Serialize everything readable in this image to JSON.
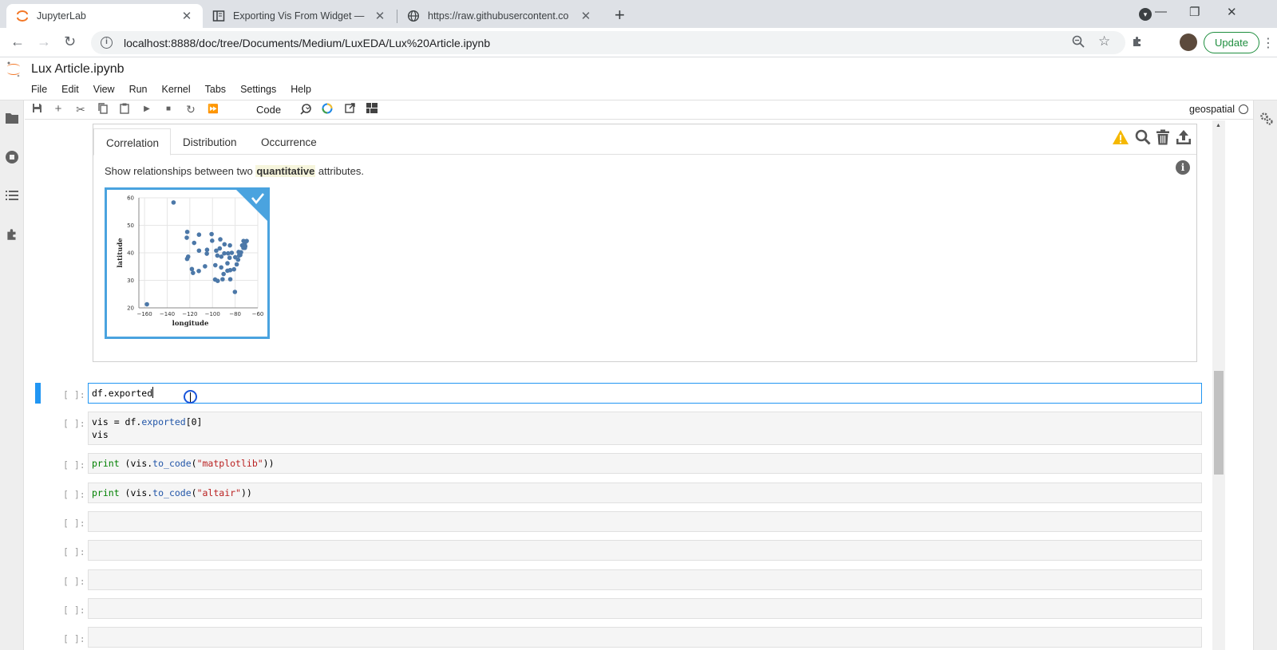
{
  "browser": {
    "tabs": [
      {
        "title": "JupyterLab",
        "active": true
      },
      {
        "title": "Exporting Vis From Widget — Lu"
      },
      {
        "title": "https://raw.githubusercontent.co"
      }
    ],
    "url": "localhost:8888/doc/tree/Documents/Medium/LuxEDA/Lux%20Article.ipynb",
    "update_label": "Update"
  },
  "jupyter": {
    "doc_title": "Lux Article.ipynb",
    "menu": [
      "File",
      "Edit",
      "View",
      "Run",
      "Kernel",
      "Tabs",
      "Settings",
      "Help"
    ],
    "cell_type": "Code",
    "kernel": "geospatial"
  },
  "lux": {
    "tabs": [
      "Correlation",
      "Distribution",
      "Occurrence"
    ],
    "active_tab": "Correlation",
    "desc_before": "Show relationships between two ",
    "desc_highlight": "quantitative",
    "desc_after": " attributes.",
    "accent": "#4aa3df"
  },
  "chart_data": {
    "type": "scatter",
    "xlabel": "longitude",
    "ylabel": "latitude",
    "xlim": [
      -165,
      -60
    ],
    "ylim": [
      20,
      60
    ],
    "xticks": [
      "−160",
      "−140",
      "−120",
      "−100",
      "−80",
      "−60"
    ],
    "yticks": [
      "20",
      "30",
      "40",
      "50",
      "60"
    ],
    "grid": true,
    "point_color": "#4c78a8",
    "points": [
      [
        -157.9,
        21.3
      ],
      [
        -134.4,
        58.3
      ],
      [
        -122.3,
        47.6
      ],
      [
        -122.7,
        45.5
      ],
      [
        -121.5,
        38.6
      ],
      [
        -122.4,
        37.8
      ],
      [
        -118.2,
        34.1
      ],
      [
        -117.2,
        32.7
      ],
      [
        -116.2,
        43.6
      ],
      [
        -111.9,
        40.8
      ],
      [
        -112.1,
        33.4
      ],
      [
        -111.9,
        46.6
      ],
      [
        -106.6,
        35.1
      ],
      [
        -105.0,
        39.7
      ],
      [
        -104.8,
        41.1
      ],
      [
        -100.8,
        46.8
      ],
      [
        -100.3,
        44.4
      ],
      [
        -96.7,
        40.8
      ],
      [
        -95.7,
        39.0
      ],
      [
        -97.5,
        35.5
      ],
      [
        -97.7,
        30.3
      ],
      [
        -95.4,
        29.8
      ],
      [
        -93.1,
        44.9
      ],
      [
        -93.6,
        41.6
      ],
      [
        -92.2,
        38.6
      ],
      [
        -92.3,
        34.7
      ],
      [
        -91.1,
        30.4
      ],
      [
        -89.4,
        43.1
      ],
      [
        -89.6,
        39.8
      ],
      [
        -90.2,
        32.3
      ],
      [
        -86.8,
        33.5
      ],
      [
        -86.8,
        36.2
      ],
      [
        -84.9,
        38.2
      ],
      [
        -86.2,
        39.8
      ],
      [
        -84.6,
        42.7
      ],
      [
        -83.0,
        40.0
      ],
      [
        -84.4,
        33.7
      ],
      [
        -84.3,
        30.4
      ],
      [
        -81.0,
        34.0
      ],
      [
        -78.6,
        35.8
      ],
      [
        -77.4,
        37.5
      ],
      [
        -79.9,
        38.4
      ],
      [
        -76.9,
        40.3
      ],
      [
        -76.5,
        39.0
      ],
      [
        -75.5,
        39.2
      ],
      [
        -74.8,
        40.2
      ],
      [
        -73.8,
        42.7
      ],
      [
        -72.7,
        41.8
      ],
      [
        -71.4,
        41.8
      ],
      [
        -71.1,
        42.4
      ],
      [
        -71.5,
        43.2
      ],
      [
        -72.6,
        44.3
      ],
      [
        -69.8,
        44.3
      ],
      [
        -80.2,
        25.8
      ]
    ]
  },
  "cells": [
    {
      "prompt": "[ ]:",
      "code": "df.exported"
    },
    {
      "prompt": "[ ]:",
      "line1_a": "vis = df.",
      "line1_b": "exported",
      "line1_c": "[0]",
      "line2": "vis"
    },
    {
      "prompt": "[ ]:",
      "kw": "print",
      "pre": " (vis.",
      "fn": "to_code",
      "p1": "(",
      "str": "\"matplotlib\"",
      "p2": "))"
    },
    {
      "prompt": "[ ]:",
      "kw": "print",
      "pre": " (vis.",
      "fn": "to_code",
      "p1": "(",
      "str": "\"altair\"",
      "p2": "))"
    },
    {
      "prompt": "[ ]:"
    },
    {
      "prompt": "[ ]:"
    },
    {
      "prompt": "[ ]:"
    },
    {
      "prompt": "[ ]:"
    },
    {
      "prompt": "[ ]:"
    }
  ]
}
